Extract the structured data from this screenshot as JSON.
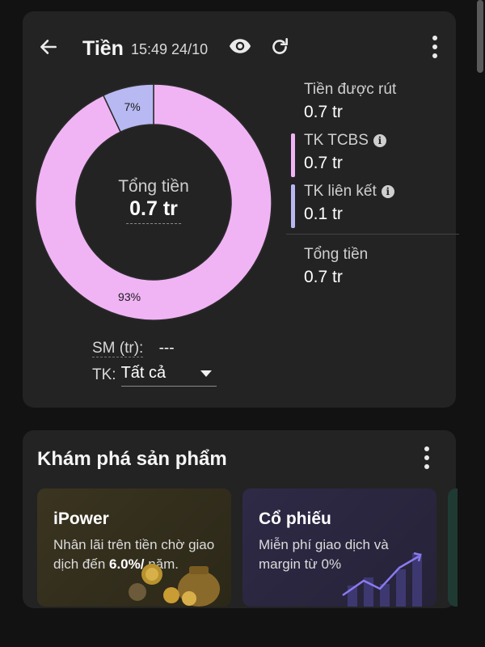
{
  "header": {
    "title": "Tiền",
    "timestamp": "15:49 24/10"
  },
  "summary": {
    "center_label": "Tổng tiền",
    "center_value": "0.7 tr",
    "legend": [
      {
        "label": "Tiền được rút",
        "value": "0.7 tr"
      },
      {
        "label": "TK TCBS",
        "value": "0.7 tr",
        "color": "#f0b4f5"
      },
      {
        "label": "TK liên kết",
        "value": "0.1 tr",
        "color": "#b8b8f2"
      },
      {
        "label": "Tổng tiền",
        "value": "0.7 tr"
      }
    ],
    "sm_label": "SM (tr):",
    "sm_value": "---",
    "tk_label": "TK:",
    "tk_value": "Tất cả"
  },
  "chart_data": {
    "type": "pie",
    "categories": [
      "TK TCBS",
      "TK liên kết"
    ],
    "values": [
      93,
      7
    ],
    "labels": [
      "93%",
      "7%"
    ],
    "colors": [
      "#f0b4f5",
      "#b8b8f2"
    ],
    "center_label": "Tổng tiền",
    "center_value": "0.7 tr"
  },
  "explore": {
    "title": "Khám phá sản phẩm",
    "products": [
      {
        "title": "iPower",
        "desc_prefix": "Nhân lãi trên tiền chờ giao dịch đến ",
        "desc_highlight": "6.0%/",
        "desc_suffix": " năm."
      },
      {
        "title": "Cổ phiếu",
        "desc": "Miễn phí giao dịch và margin từ 0%"
      }
    ]
  },
  "colors": {
    "background": "#121212",
    "card": "#232323",
    "tcbs": "#f0b4f5",
    "linked": "#b8b8f2"
  },
  "icons": [
    "back-arrow-icon",
    "eye-icon",
    "refresh-icon",
    "more-vertical-icon",
    "info-icon",
    "caret-down-icon"
  ]
}
